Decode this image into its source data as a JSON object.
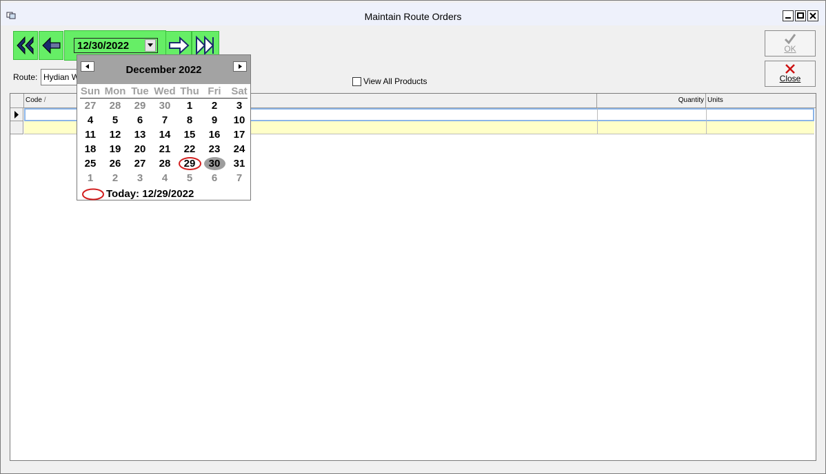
{
  "window": {
    "title": "Maintain Route Orders"
  },
  "toolbar": {
    "date_value": "12/30/2022",
    "route_label": "Route:",
    "route_value": "Hydian W",
    "view_all_label": "View All Products",
    "ok_label": "OK",
    "close_label": "Close"
  },
  "grid": {
    "columns": [
      "Code",
      "Quantity",
      "Units"
    ]
  },
  "calendar": {
    "month_title": "December 2022",
    "weekdays": [
      "Sun",
      "Mon",
      "Tue",
      "Wed",
      "Thu",
      "Fri",
      "Sat"
    ],
    "weeks": [
      [
        "27",
        "28",
        "29",
        "30",
        "1",
        "2",
        "3"
      ],
      [
        "4",
        "5",
        "6",
        "7",
        "8",
        "9",
        "10"
      ],
      [
        "11",
        "12",
        "13",
        "14",
        "15",
        "16",
        "17"
      ],
      [
        "18",
        "19",
        "20",
        "21",
        "22",
        "23",
        "24"
      ],
      [
        "25",
        "26",
        "27",
        "28",
        "29",
        "30",
        "31"
      ],
      [
        "1",
        "2",
        "3",
        "4",
        "5",
        "6",
        "7"
      ]
    ],
    "today_label": "Today: 12/29/2022"
  },
  "colors": {
    "nav_green": "#66ee66",
    "today_ring": "#d21e1e",
    "selected_day_bg": "#9d9d9d",
    "new_row_bg": "#ffffc8"
  }
}
